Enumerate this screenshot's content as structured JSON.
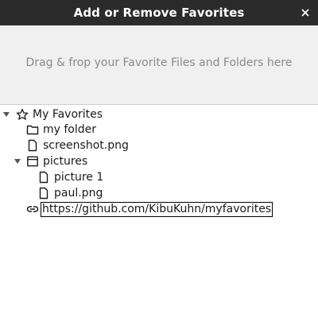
{
  "window": {
    "title": "Add or Remove Favorites",
    "close_glyph": "×"
  },
  "dropzone": {
    "hint": "Drag & frop your Favorite Files and Folders here"
  },
  "tree": {
    "root": {
      "label": "My Favorites",
      "icon": "star-icon",
      "expanded": true
    },
    "items": [
      {
        "label": "my folder",
        "icon": "folder-icon"
      },
      {
        "label": "screenshot.png",
        "icon": "file-icon"
      },
      {
        "label": "pictures",
        "icon": "window-icon",
        "expanded": true,
        "children": [
          {
            "label": "picture 1",
            "icon": "file-icon"
          },
          {
            "label": "paul.png",
            "icon": "file-icon"
          }
        ]
      },
      {
        "label": "https://github.com/KibuKuhn/myfavorites",
        "icon": "link-icon",
        "editing": true
      }
    ]
  },
  "colors": {
    "titlebar": "#2b2b2b",
    "dropzone": "#f0f0f0",
    "hint_text": "#8a8a8a"
  }
}
